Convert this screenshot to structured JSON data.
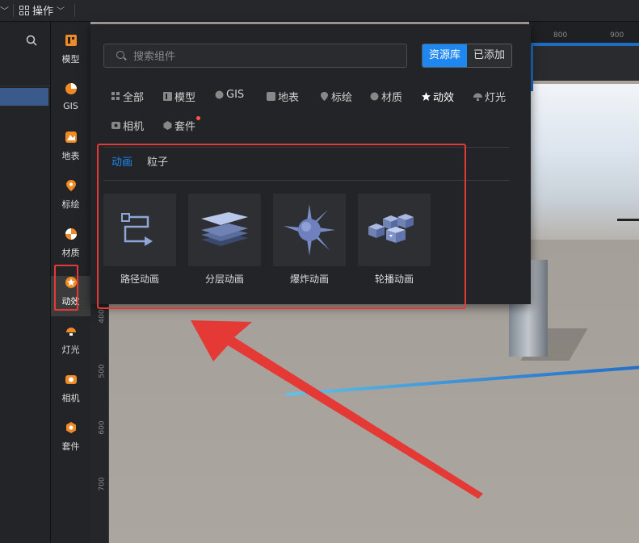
{
  "topbar": {
    "ops_label": "操作"
  },
  "sidebar": {
    "items": [
      {
        "label": "模型",
        "icon": "model-icon"
      },
      {
        "label": "GIS",
        "icon": "gis-icon"
      },
      {
        "label": "地表",
        "icon": "terrain-icon"
      },
      {
        "label": "标绘",
        "icon": "pin-icon"
      },
      {
        "label": "材质",
        "icon": "material-icon"
      },
      {
        "label": "动效",
        "icon": "effect-icon"
      },
      {
        "label": "灯光",
        "icon": "light-icon"
      },
      {
        "label": "相机",
        "icon": "camera-icon"
      },
      {
        "label": "套件",
        "icon": "kit-icon"
      }
    ],
    "active_index": 5
  },
  "panel": {
    "search_placeholder": "搜索组件",
    "segment": {
      "library": "资源库",
      "added": "已添加"
    },
    "tabs": [
      {
        "label": "全部",
        "icon": "grid-icon"
      },
      {
        "label": "模型",
        "icon": "model-icon"
      },
      {
        "label": "GIS",
        "icon": "gis-icon"
      },
      {
        "label": "地表",
        "icon": "terrain-icon"
      },
      {
        "label": "标绘",
        "icon": "pin-icon"
      },
      {
        "label": "材质",
        "icon": "material-icon"
      },
      {
        "label": "动效",
        "icon": "effect-icon"
      },
      {
        "label": "灯光",
        "icon": "light-icon"
      },
      {
        "label": "相机",
        "icon": "camera-icon"
      },
      {
        "label": "套件",
        "icon": "kit-icon"
      }
    ],
    "active_tab": "动效",
    "subtabs": [
      "动画",
      "粒子"
    ],
    "active_subtab": "动画",
    "cards": [
      {
        "label": "路径动画",
        "icon": "path-animation-icon"
      },
      {
        "label": "分层动画",
        "icon": "layer-animation-icon"
      },
      {
        "label": "爆炸动画",
        "icon": "explosion-animation-icon"
      },
      {
        "label": "轮播动画",
        "icon": "carousel-animation-icon"
      }
    ]
  },
  "viewport": {
    "ruler_top": [
      "800",
      "900"
    ],
    "ruler_left": [
      "400",
      "500",
      "600",
      "700"
    ]
  },
  "colors": {
    "accent": "#1e87f0",
    "icon_orange": "#f08a24",
    "annotation_red": "#e53935"
  }
}
